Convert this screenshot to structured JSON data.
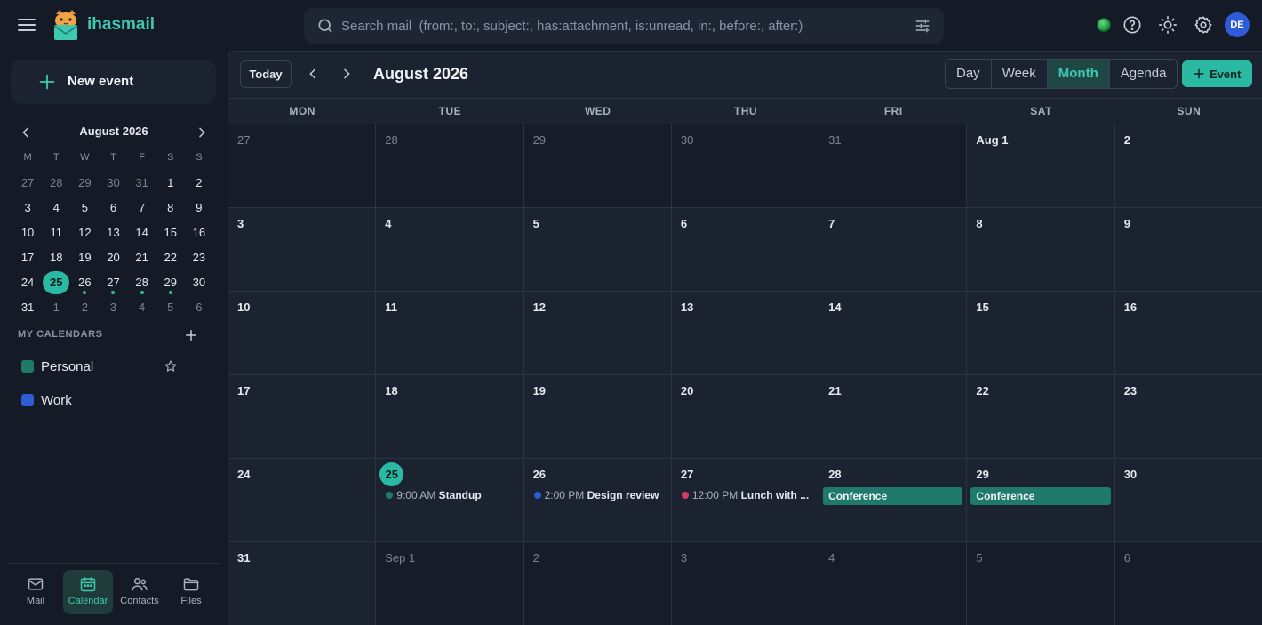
{
  "app": {
    "brand": "ihasmail"
  },
  "search": {
    "placeholder": "Search mail  (from:, to:, subject:, has:attachment, is:unread, in:, before:, after:)"
  },
  "user": {
    "initials": "DE"
  },
  "sidebar": {
    "new_event_label": "New event",
    "mini_calendar": {
      "title": "August 2026",
      "weekday_headers": [
        "M",
        "T",
        "W",
        "T",
        "F",
        "S",
        "S"
      ],
      "weeks": [
        [
          {
            "d": "27",
            "out": true
          },
          {
            "d": "28",
            "out": true
          },
          {
            "d": "29",
            "out": true
          },
          {
            "d": "30",
            "out": true
          },
          {
            "d": "31",
            "out": true
          },
          {
            "d": "1"
          },
          {
            "d": "2"
          }
        ],
        [
          {
            "d": "3"
          },
          {
            "d": "4"
          },
          {
            "d": "5"
          },
          {
            "d": "6"
          },
          {
            "d": "7"
          },
          {
            "d": "8"
          },
          {
            "d": "9"
          }
        ],
        [
          {
            "d": "10"
          },
          {
            "d": "11"
          },
          {
            "d": "12"
          },
          {
            "d": "13"
          },
          {
            "d": "14"
          },
          {
            "d": "15"
          },
          {
            "d": "16"
          }
        ],
        [
          {
            "d": "17"
          },
          {
            "d": "18"
          },
          {
            "d": "19"
          },
          {
            "d": "20"
          },
          {
            "d": "21"
          },
          {
            "d": "22"
          },
          {
            "d": "23"
          }
        ],
        [
          {
            "d": "24"
          },
          {
            "d": "25",
            "today": true
          },
          {
            "d": "26",
            "dot": true
          },
          {
            "d": "27",
            "dot": true
          },
          {
            "d": "28",
            "dot": true
          },
          {
            "d": "29",
            "dot": true
          },
          {
            "d": "30"
          }
        ],
        [
          {
            "d": "31"
          },
          {
            "d": "1",
            "out": true
          },
          {
            "d": "2",
            "out": true
          },
          {
            "d": "3",
            "out": true
          },
          {
            "d": "4",
            "out": true
          },
          {
            "d": "5",
            "out": true
          },
          {
            "d": "6",
            "out": true
          }
        ]
      ]
    },
    "my_calendars_label": "MY CALENDARS",
    "calendars": [
      {
        "name": "Personal",
        "color": "#1f7a6c"
      },
      {
        "name": "Work",
        "color": "#2f5bd8"
      }
    ],
    "bottom_nav": [
      {
        "label": "Mail",
        "icon": "mail-icon"
      },
      {
        "label": "Calendar",
        "icon": "calendar-icon",
        "active": true
      },
      {
        "label": "Contacts",
        "icon": "contacts-icon"
      },
      {
        "label": "Files",
        "icon": "folder-icon"
      }
    ]
  },
  "toolbar": {
    "today_label": "Today",
    "title": "August 2026",
    "views": [
      {
        "label": "Day"
      },
      {
        "label": "Week"
      },
      {
        "label": "Month",
        "active": true
      },
      {
        "label": "Agenda"
      }
    ],
    "add_event_label": "Event"
  },
  "colors": {
    "accent": "#2ab9a3",
    "personal": "#1f7a6c",
    "work": "#2f5bd8",
    "lunch": "#d63a6c"
  },
  "month": {
    "weekdays": [
      "MON",
      "TUE",
      "WED",
      "THU",
      "FRI",
      "SAT",
      "SUN"
    ],
    "weeks": [
      [
        {
          "label": "27",
          "out": true
        },
        {
          "label": "28",
          "out": true
        },
        {
          "label": "29",
          "out": true
        },
        {
          "label": "30",
          "out": true
        },
        {
          "label": "31",
          "out": true
        },
        {
          "label": "Aug 1"
        },
        {
          "label": "2"
        }
      ],
      [
        {
          "label": "3"
        },
        {
          "label": "4"
        },
        {
          "label": "5"
        },
        {
          "label": "6"
        },
        {
          "label": "7"
        },
        {
          "label": "8"
        },
        {
          "label": "9"
        }
      ],
      [
        {
          "label": "10"
        },
        {
          "label": "11"
        },
        {
          "label": "12"
        },
        {
          "label": "13"
        },
        {
          "label": "14"
        },
        {
          "label": "15"
        },
        {
          "label": "16"
        }
      ],
      [
        {
          "label": "17"
        },
        {
          "label": "18"
        },
        {
          "label": "19"
        },
        {
          "label": "20"
        },
        {
          "label": "21"
        },
        {
          "label": "22"
        },
        {
          "label": "23"
        }
      ],
      [
        {
          "label": "24"
        },
        {
          "label": "25",
          "today": true,
          "events": [
            {
              "time": "9:00 AM",
              "title": "Standup",
              "color": "#1f7a6c"
            }
          ]
        },
        {
          "label": "26",
          "events": [
            {
              "time": "2:00 PM",
              "title": "Design review",
              "color": "#2f5bd8"
            }
          ]
        },
        {
          "label": "27",
          "events": [
            {
              "time": "12:00 PM",
              "title": "Lunch with ...",
              "color": "#d63a6c"
            }
          ]
        },
        {
          "label": "28",
          "allday": [
            {
              "title": "Conference"
            }
          ]
        },
        {
          "label": "29",
          "allday": [
            {
              "title": "Conference"
            }
          ]
        },
        {
          "label": "30"
        }
      ],
      [
        {
          "label": "31"
        },
        {
          "label": "Sep 1",
          "out": true
        },
        {
          "label": "2",
          "out": true
        },
        {
          "label": "3",
          "out": true
        },
        {
          "label": "4",
          "out": true
        },
        {
          "label": "5",
          "out": true
        },
        {
          "label": "6",
          "out": true
        }
      ]
    ]
  }
}
